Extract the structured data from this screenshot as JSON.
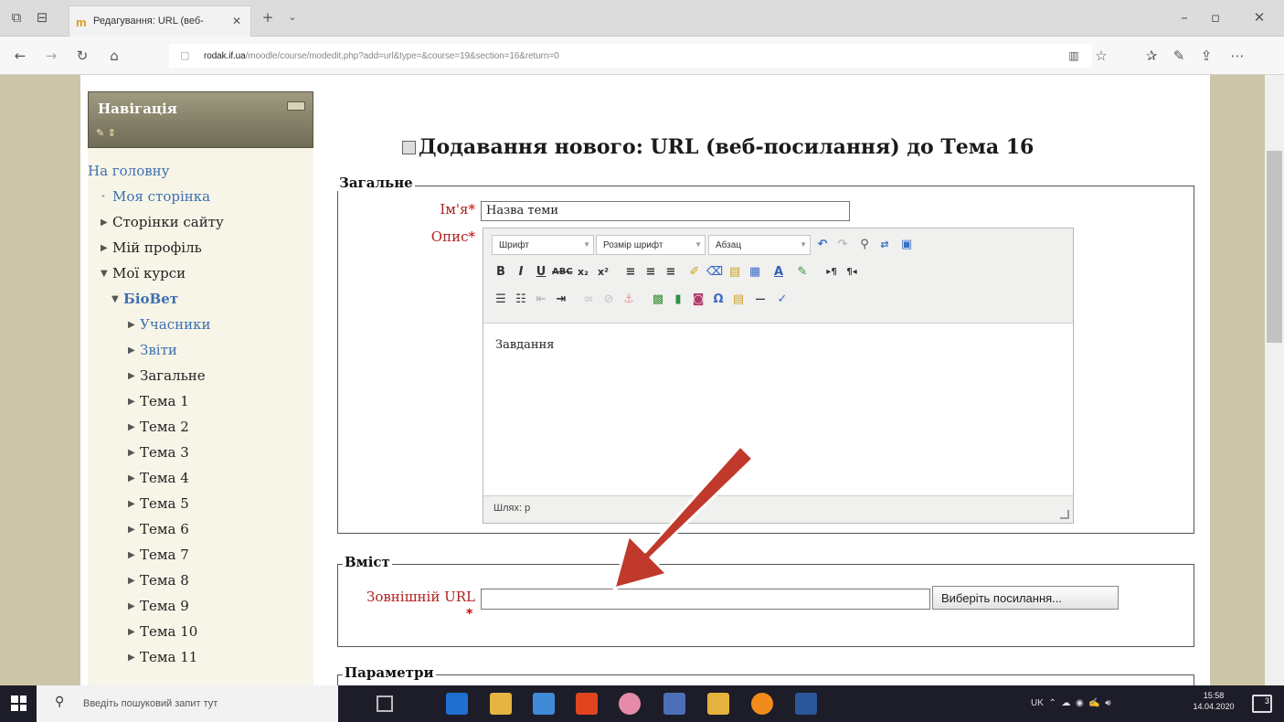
{
  "browser": {
    "tab_title": "Редагування: URL (веб-",
    "url_host": "rodak.if.ua",
    "url_path": "/moodle/course/modedit.php?add=url&type=&course=19&section=16&return=0"
  },
  "nav": {
    "title": "Навігація",
    "items": [
      {
        "label": "На головну"
      },
      {
        "label": "Моя сторінка"
      },
      {
        "label": "Сторінки сайту"
      },
      {
        "label": "Мій профіль"
      },
      {
        "label": "Мої курси"
      },
      {
        "label": "БіоВет"
      },
      {
        "label": "Учасники"
      },
      {
        "label": "Звіти"
      },
      {
        "label": "Загальне"
      },
      {
        "label": "Тема 1"
      },
      {
        "label": "Тема 2"
      },
      {
        "label": "Тема 3"
      },
      {
        "label": "Тема 4"
      },
      {
        "label": "Тема 5"
      },
      {
        "label": "Тема 6"
      },
      {
        "label": "Тема 7"
      },
      {
        "label": "Тема 8"
      },
      {
        "label": "Тема 9"
      },
      {
        "label": "Тема 10"
      },
      {
        "label": "Тема 11"
      }
    ]
  },
  "main": {
    "heading": "Додавання нового: URL (веб-посилання) до Тема 16",
    "general": {
      "legend": "Загальне",
      "name_label": "Ім'я",
      "name_value": "Назва теми",
      "desc_label": "Опис",
      "required_mark": "*"
    },
    "editor": {
      "font_select": "Шрифт",
      "size_select": "Розмір шрифт",
      "format_select": "Абзац",
      "content": "Завдання",
      "path": "Шлях: p"
    },
    "content": {
      "legend": "Вміст",
      "url_label": "Зовнішній URL",
      "url_value": "",
      "choose_button": "Виберіть посилання..."
    },
    "params": {
      "legend": "Параметри"
    }
  },
  "taskbar": {
    "search_placeholder": "Введіть пошуковий запит тут",
    "lang": "UK",
    "time": "15:58",
    "date": "14.04.2020",
    "notifications": "3"
  },
  "colors": {
    "required": "#c00000",
    "link": "#3e6fb0",
    "arrow": "#c0392b"
  }
}
